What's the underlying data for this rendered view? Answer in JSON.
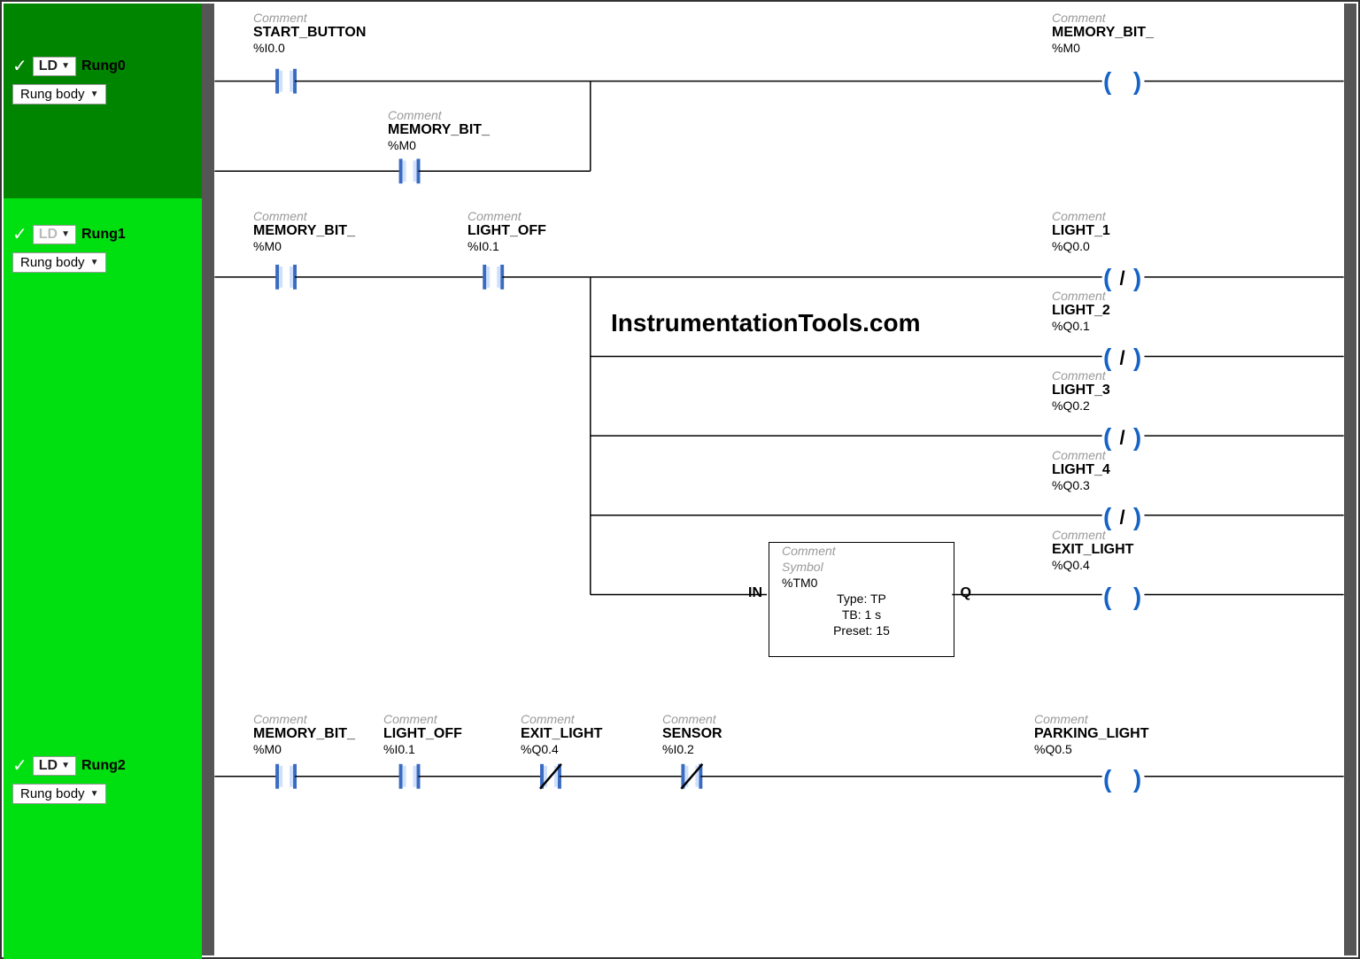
{
  "sidebar": {
    "rungs": [
      {
        "id": "Rung0",
        "ld": "LD",
        "body": "Rung body",
        "dark": true,
        "disabled": false
      },
      {
        "id": "Rung1",
        "ld": "LD",
        "body": "Rung body",
        "dark": false,
        "disabled": true
      },
      {
        "id": "Rung2",
        "ld": "LD",
        "body": "Rung body",
        "dark": false,
        "disabled": false
      }
    ]
  },
  "editor": {
    "watermark": "InstrumentationTools.com",
    "rung0": {
      "elements": {
        "start_button": {
          "comment": "Comment",
          "name": "START_BUTTON",
          "addr": "%I0.0"
        },
        "memory_bit_branch": {
          "comment": "Comment",
          "name": "MEMORY_BIT_",
          "addr": "%M0"
        },
        "coil_memory": {
          "comment": "Comment",
          "name": "MEMORY_BIT_",
          "addr": "%M0"
        }
      }
    },
    "rung1": {
      "in": {
        "memory_bit": {
          "comment": "Comment",
          "name": "MEMORY_BIT_",
          "addr": "%M0"
        },
        "light_off": {
          "comment": "Comment",
          "name": "LIGHT_OFF",
          "addr": "%I0.1"
        }
      },
      "coils": [
        {
          "comment": "Comment",
          "name": "LIGHT_1",
          "addr": "%Q0.0",
          "neg": true
        },
        {
          "comment": "Comment",
          "name": "LIGHT_2",
          "addr": "%Q0.1",
          "neg": true
        },
        {
          "comment": "Comment",
          "name": "LIGHT_3",
          "addr": "%Q0.2",
          "neg": true
        },
        {
          "comment": "Comment",
          "name": "LIGHT_4",
          "addr": "%Q0.3",
          "neg": true
        },
        {
          "comment": "Comment",
          "name": "EXIT_LIGHT",
          "addr": "%Q0.4",
          "neg": false
        }
      ],
      "timer": {
        "comment": "Comment",
        "symbol_label": "Symbol",
        "addr": "%TM0",
        "type": "Type: TP",
        "tb": "TB: 1 s",
        "preset": "Preset: 15",
        "in_label": "IN",
        "q_label": "Q"
      }
    },
    "rung2": {
      "in": {
        "memory_bit": {
          "comment": "Comment",
          "name": "MEMORY_BIT_",
          "addr": "%M0"
        },
        "light_off": {
          "comment": "Comment",
          "name": "LIGHT_OFF",
          "addr": "%I0.1"
        },
        "exit_light": {
          "comment": "Comment",
          "name": "EXIT_LIGHT",
          "addr": "%Q0.4"
        },
        "sensor": {
          "comment": "Comment",
          "name": "SENSOR",
          "addr": "%I0.2"
        }
      },
      "coil": {
        "comment": "Comment",
        "name": "PARKING_LIGHT",
        "addr": "%Q0.5",
        "neg": false
      }
    }
  },
  "chart_data": {
    "type": "ladder-diagram",
    "rungs": [
      {
        "name": "Rung0",
        "logic": "START_BUTTON(%I0.0, NO) OR MEMORY_BIT_(%M0, NO) → ( ) MEMORY_BIT_(%M0)"
      },
      {
        "name": "Rung1",
        "logic": "MEMORY_BIT_(%M0, NO) AND LIGHT_OFF(%I0.1, NO) → (/) LIGHT_1(%Q0.0); (/) LIGHT_2(%Q0.1); (/) LIGHT_3(%Q0.2); (/) LIGHT_4(%Q0.3); TM0(TP, TB=1s, Preset=15).Q → ( ) EXIT_LIGHT(%Q0.4)"
      },
      {
        "name": "Rung2",
        "logic": "MEMORY_BIT_(%M0, NO) AND LIGHT_OFF(%I0.1, NO) AND EXIT_LIGHT(%Q0.4, NC) AND SENSOR(%I0.2, NC) → ( ) PARKING_LIGHT(%Q0.5)"
      }
    ]
  }
}
